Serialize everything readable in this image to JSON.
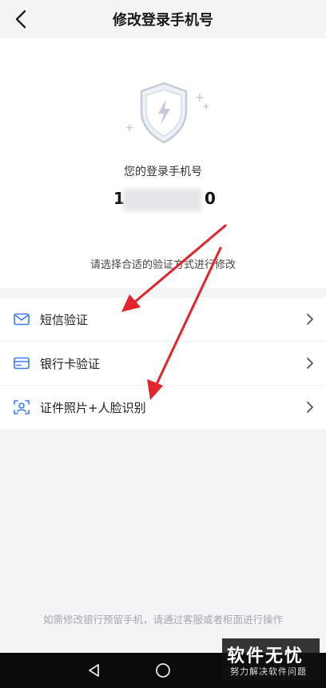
{
  "header": {
    "title": "修改登录手机号"
  },
  "account": {
    "caption": "您的登录手机号",
    "phone_partial_start": "1",
    "phone_partial_end": "0"
  },
  "hint": "请选择合适的验证方式进行修改",
  "methods": [
    {
      "label": "短信验证",
      "icon": "mail-icon"
    },
    {
      "label": "银行卡验证",
      "icon": "card-icon"
    },
    {
      "label": "证件照片+人脸识别",
      "icon": "face-scan-icon"
    }
  ],
  "footer_note": "如需修改银行预留手机，请通过客服或者柜面进行操作",
  "watermark": {
    "title": "软件无忧",
    "subtitle": "努力解决软件问题"
  },
  "colors": {
    "accent": "#3a7bfa",
    "annotation_arrow": "#e3242b"
  }
}
